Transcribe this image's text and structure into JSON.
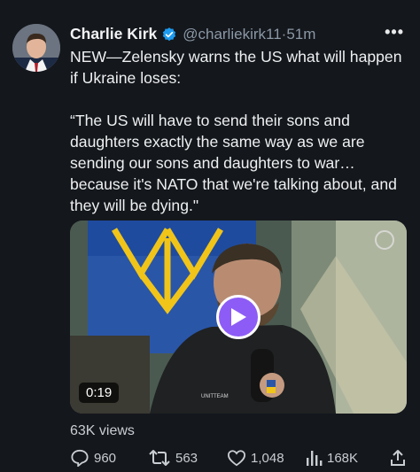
{
  "author": {
    "name": "Charlie Kirk",
    "handle": "@charliekirk11",
    "separator": "·",
    "time": "51m",
    "verified_icon": "verified-badge-icon"
  },
  "more_label": "•••",
  "tweet": {
    "line1": "NEW—Zelensky warns the US what will happen if Ukraine loses:",
    "quote": "“The US will have to send their sons and daughters exactly the same way as we are sending our sons and daughters to war… because it's NATO that we're talking about, and they will be dying.\""
  },
  "media": {
    "duration": "0:19",
    "play_icon": "play-icon",
    "colors": {
      "play_button": "#8d5cf6",
      "flag_blue": "#2a56a8",
      "trident_yellow": "#f0c419"
    }
  },
  "views_label": "63K views",
  "actions": {
    "replies": "960",
    "reposts": "563",
    "likes": "1,048",
    "views": "168K"
  }
}
